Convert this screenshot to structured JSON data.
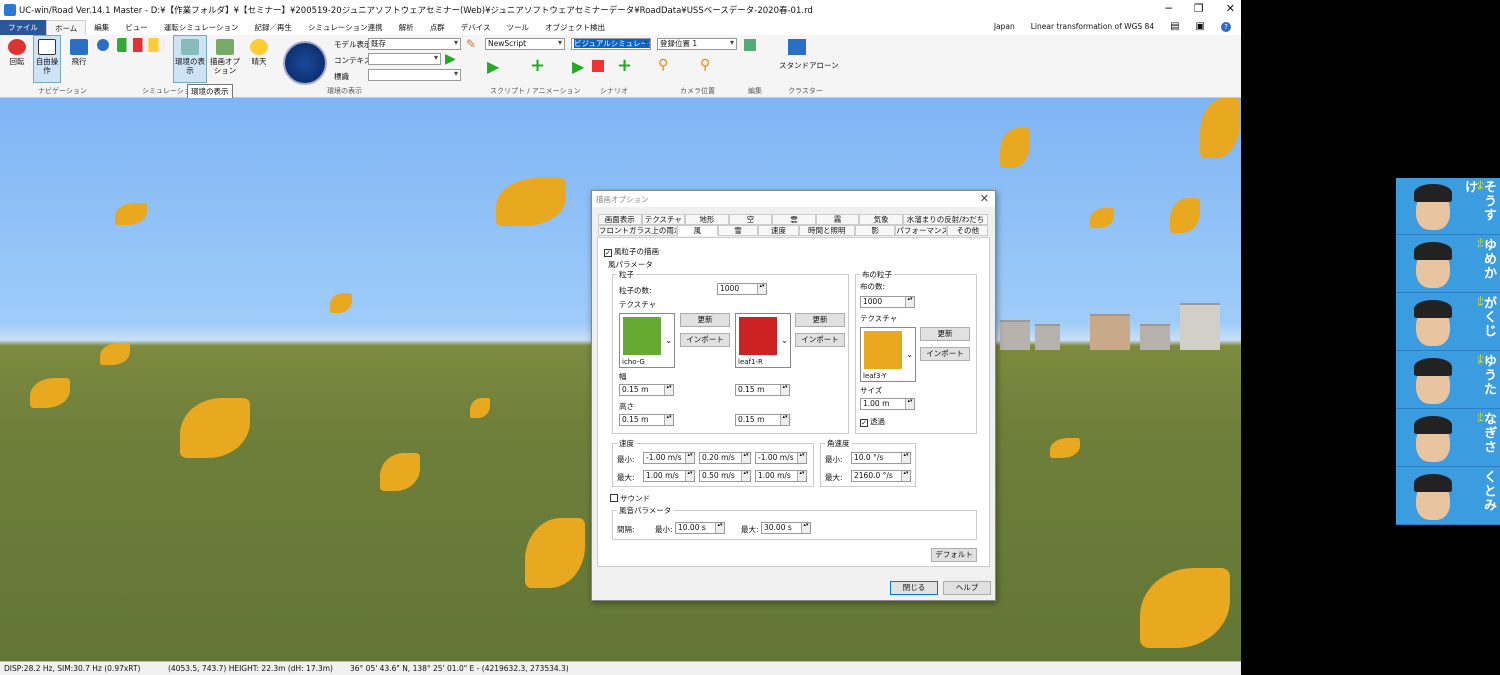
{
  "window": {
    "title": "UC-win/Road Ver.14.1 Master - D:¥【作業フォルダ】¥【セミナー】¥200519-20ジュニアソフトウェアセミナー(Web)¥ジュニアソフトウェアセミナーデータ¥RoadData¥USSベースデータ-2020春-01.rd"
  },
  "menu_tabs": [
    {
      "label": "ファイル"
    },
    {
      "label": "ホーム"
    },
    {
      "label": "編集"
    },
    {
      "label": "ビュー"
    },
    {
      "label": "運転シミュレーション"
    },
    {
      "label": "記録／再生"
    },
    {
      "label": "シミュレーション連携"
    },
    {
      "label": "解析"
    },
    {
      "label": "点群"
    },
    {
      "label": "デバイス"
    },
    {
      "label": "ツール"
    },
    {
      "label": "オブジェクト検出"
    }
  ],
  "tab_right": {
    "region": "Japan",
    "projection": "Linear transformation of WGS 84"
  },
  "ribbon": {
    "rotate": "回転",
    "free_op": "自由操作",
    "fly": "飛行",
    "env_display": "環境の表示",
    "draw_opt": "描画オプション",
    "weather": "晴天",
    "nav_group": "ナビゲーション",
    "sim_group": "シミュレーション",
    "env_group": "環境の表示",
    "script_group": "スクリプト / アニメーション",
    "scenario_group": "シナリオ",
    "camera_group": "カメラ位置",
    "edit_group": "編集",
    "cluster_group": "クラスター",
    "model_display_label": "モデル表示",
    "model_display_value": "既存",
    "context_label": "コンテキスト",
    "context_value": "",
    "marker_label": "標識",
    "marker_value": "",
    "script_value": "NewScript",
    "scenario_value": "ビジュアルシミュレーション",
    "camera_value": "登録位置 1",
    "standalone": "スタンドアローン",
    "tooltip": "環境の表示"
  },
  "dialog": {
    "title": "描画オプション",
    "tabs_row1": [
      {
        "label": "画面表示"
      },
      {
        "label": "テクスチャ"
      },
      {
        "label": "地形"
      },
      {
        "label": "空"
      },
      {
        "label": "雲"
      },
      {
        "label": "霧"
      },
      {
        "label": "気象"
      },
      {
        "label": "水溜まりの反射/わだち"
      }
    ],
    "tabs_row2": [
      {
        "label": "フロントガラス上の雨水"
      },
      {
        "label": "風"
      },
      {
        "label": "雪"
      },
      {
        "label": "速度"
      },
      {
        "label": "時間と照明"
      },
      {
        "label": "影"
      },
      {
        "label": "パフォーマンス"
      },
      {
        "label": "その他"
      }
    ],
    "wind_particles_check": "風粒子の描画",
    "wind_params": "風パラメータ",
    "particles": {
      "title": "粒子",
      "count_label": "粒子の数:",
      "count": "1000",
      "texture_label": "テクスチャ",
      "tex1": "icho-G",
      "tex2": "leaf1-R",
      "update": "更新",
      "import": "インポート",
      "width_label": "幅",
      "height_label": "高さ",
      "w1": "0.15 m",
      "w2": "0.15 m",
      "h1": "0.15 m",
      "h2": "0.15 m"
    },
    "cloth": {
      "title": "布の粒子",
      "count_label": "布の数:",
      "count": "1000",
      "texture_label": "テクスチャ",
      "tex": "leaf3-Y",
      "update": "更新",
      "import": "インポート",
      "size_label": "サイズ",
      "size": "1.00 m",
      "transparent": "透過"
    },
    "velocity": {
      "title": "速度",
      "min_label": "最小:",
      "max_label": "最大:",
      "min": [
        "-1.00 m/s",
        "0.20 m/s",
        "-1.00 m/s"
      ],
      "max": [
        "1.00 m/s",
        "0.50 m/s",
        "1.00 m/s"
      ]
    },
    "angular": {
      "title": "角速度",
      "min_label": "最小:",
      "max_label": "最大:",
      "min": "10.0 °/s",
      "max": "2160.0 °/s"
    },
    "sound_check": "サウンド",
    "sound_params": "風音パラメータ",
    "interval_label": "間隔:",
    "sound_min_label": "最小:",
    "sound_min": "10.00 s",
    "sound_max_label": "最大:",
    "sound_max": "30.00 s",
    "default_btn": "デフォルト",
    "close_btn": "閉じる",
    "help_btn": "ヘルプ"
  },
  "statusbar": {
    "disp": "DISP:28.2 Hz, SIM:30.7 Hz (0.97xRT)",
    "pos": "(4053.5, 743.7)  HEIGHT: 22.3m (dH: 17.3m)",
    "geo": "36° 05' 43.6\" N, 138° 25' 01.0\" E - (4219632.3, 273534.3)"
  },
  "participants": [
    {
      "grade": "小6",
      "name": "そうすけ"
    },
    {
      "grade": "小1",
      "name": "ゆめか"
    },
    {
      "grade": "小3",
      "name": "がくじ"
    },
    {
      "grade": "小6",
      "name": "ゆうた"
    },
    {
      "grade": "小3",
      "name": "なぎさ"
    },
    {
      "grade": "",
      "name": "くとみ"
    }
  ]
}
